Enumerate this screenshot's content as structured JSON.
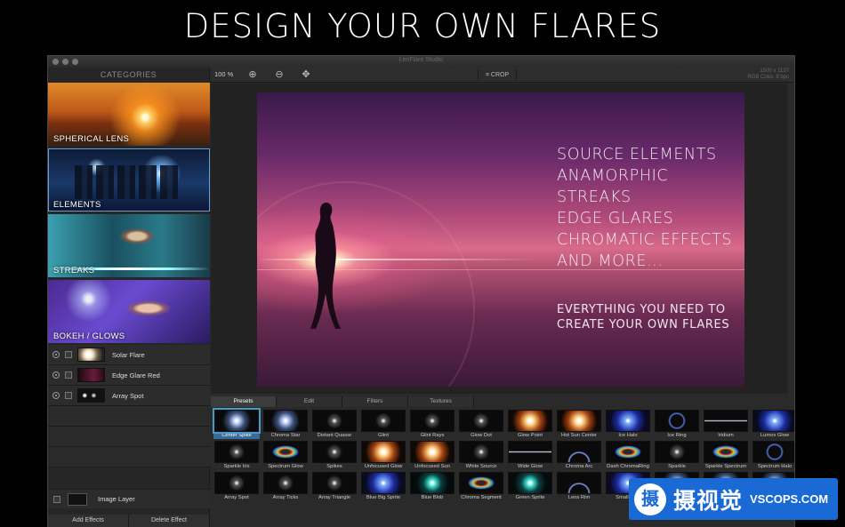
{
  "headline": "DESIGN YOUR OWN FLARES",
  "window": {
    "title": "LenFlare Studio"
  },
  "sidebar": {
    "header": "CATEGORIES",
    "categories": [
      {
        "label": "SPHERICAL LENS"
      },
      {
        "label": "ELEMENTS"
      },
      {
        "label": "STREAKS"
      },
      {
        "label": "BOKEH / GLOWS"
      }
    ],
    "layers": [
      {
        "name": "Solar Flare"
      },
      {
        "name": "Edge Glare Red"
      },
      {
        "name": "Array Spot"
      }
    ],
    "image_layer": "Image Layer",
    "add_effects": "Add Effects",
    "delete_effect": "Delete Effect"
  },
  "toolbar": {
    "zoom": "100 %",
    "crop": "CROP",
    "image_size": "1500 x 1137",
    "color_mode": "RGB Color, 8 bpc"
  },
  "photo": {
    "lines": [
      "SOURCE ELEMENTS",
      "ANAMORPHIC STREAKS",
      "EDGE GLARES",
      "CHROMATIC EFFECTS",
      "AND MORE..."
    ],
    "tagline": [
      "EVERYTHING YOU NEED TO",
      "CREATE YOUR OWN FLARES"
    ]
  },
  "tabs": [
    "Presets",
    "Edit",
    "Filters",
    "Textures"
  ],
  "presets": [
    "Center Spike",
    "Chroma Star",
    "Distant Quasar",
    "Glint",
    "Glint Rays",
    "Glow Dot",
    "Glow Point",
    "Hot Sun Center",
    "Ice Halo",
    "Ice Ring",
    "Iridium",
    "Lumos Glow",
    "Sparkle Iris",
    "Spectrum Glow",
    "Spikes",
    "Unfocused Glow",
    "Unfocused Sun",
    "White Source",
    "Wide Glow",
    "Chroma Arc",
    "Dash ChromaRing",
    "Sparkle",
    "Sparkle Spectrum",
    "Spectrum Halo",
    "Array Spot",
    "Array Ticks",
    "Array Triangle",
    "Blue Big Sprite",
    "Blue Blob",
    "Chroma Segment",
    "Green Sprite",
    "Lens Rim",
    "Small Blue",
    "",
    "",
    ""
  ],
  "watermark": {
    "logo": "摄",
    "cn": "摄视觉",
    "en": "VSCOPS.COM"
  }
}
